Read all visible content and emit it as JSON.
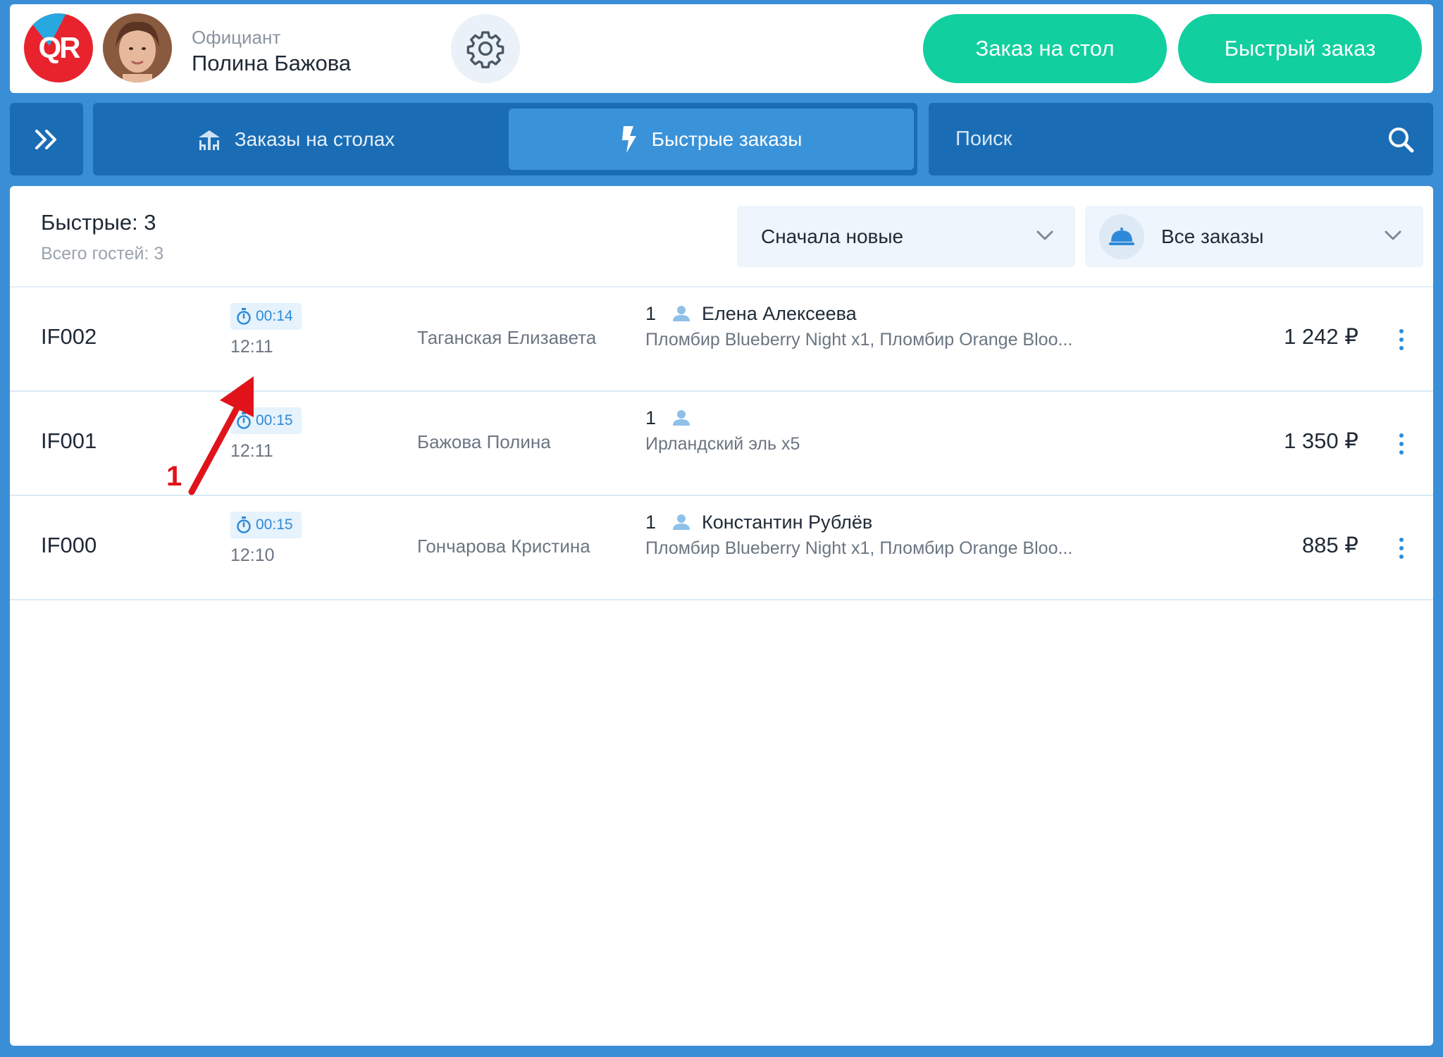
{
  "header": {
    "logo_text": "QR",
    "role_label": "Официант",
    "waiter_name": "Полина Бажова",
    "btn_table_order": "Заказ на стол",
    "btn_quick_order": "Быстрый заказ"
  },
  "nav": {
    "tabs": [
      {
        "label": "Заказы на столах",
        "icon": "table-icon"
      },
      {
        "label": "Быстрые заказы",
        "icon": "lightning-icon"
      }
    ],
    "search": {
      "placeholder": "Поиск"
    }
  },
  "summary": {
    "title": "Быстрые: 3",
    "guests": "Всего гостей: 3"
  },
  "filters": {
    "sort_selected": "Сначала новые",
    "type_selected": "Все заказы"
  },
  "orders": [
    {
      "id": "IF002",
      "timer": "00:14",
      "time": "12:11",
      "waiter": "Таганская Елизавета",
      "guests": "1",
      "guest_name": "Елена Алексеева",
      "items": "Пломбир Blueberry Night x1, Пломбир Orange Bloo...",
      "total": "1 242 ₽"
    },
    {
      "id": "IF001",
      "timer": "00:15",
      "time": "12:11",
      "waiter": "Бажова Полина",
      "guests": "1",
      "guest_name": "",
      "items": "Ирландский эль x5",
      "total": "1 350 ₽"
    },
    {
      "id": "IF000",
      "timer": "00:15",
      "time": "12:10",
      "waiter": "Гончарова Кристина",
      "guests": "1",
      "guest_name": "Константин Рублёв",
      "items": "Пломбир Blueberry Night x1, Пломбир Orange Bloo...",
      "total": "885 ₽"
    }
  ],
  "annotation": {
    "label": "1"
  },
  "colors": {
    "accent_green": "#12cf9f",
    "nav_blue": "#1a6db5",
    "active_tab": "#3a93d9",
    "background": "#3a8ed6",
    "link_blue": "#2e8ad8",
    "logo_red": "#e8232d",
    "annotation_red": "#e0131a"
  }
}
